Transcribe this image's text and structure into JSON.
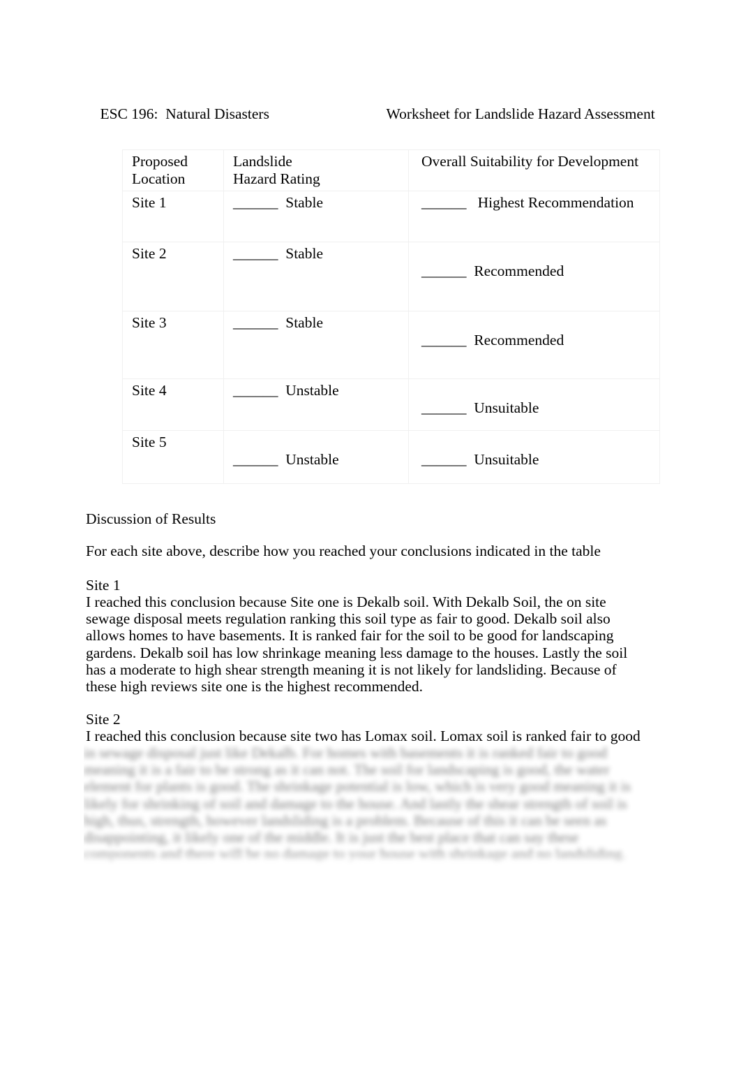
{
  "header": {
    "course": "ESC 196:  Natural Disasters",
    "worksheet_title": "Worksheet for Landslide Hazard Assessment"
  },
  "table": {
    "columns": [
      "Proposed\nLocation",
      "Landslide\nHazard Rating",
      "Overall Suitability for Development"
    ],
    "column_headers_flat": {
      "location": "Proposed Location",
      "rating": "Landslide Hazard Rating",
      "suitability": "Overall Suitability for Development"
    },
    "blank": "______",
    "rows": [
      {
        "location": "Site 1",
        "rating_blank": "______",
        "rating": "Stable",
        "suitability_blank": "______",
        "suitability": "Highest Recommendation",
        "suitability_offset": false
      },
      {
        "location": "Site 2",
        "rating_blank": "______",
        "rating": "Stable",
        "suitability_blank": "______",
        "suitability": "Recommended",
        "suitability_offset": true
      },
      {
        "location": "Site 3",
        "rating_blank": "______",
        "rating": "Stable",
        "suitability_blank": "______",
        "suitability": "Recommended",
        "suitability_offset": true
      },
      {
        "location": "Site 4",
        "rating_blank": "______",
        "rating": "Unstable",
        "suitability_blank": "______",
        "suitability": "Unsuitable",
        "suitability_offset": true
      },
      {
        "location": "Site 5",
        "rating_blank": "______",
        "rating": "Unstable",
        "suitability_blank": "______",
        "suitability": "Unsuitable",
        "suitability_offset": true
      }
    ]
  },
  "discussion": {
    "heading": "Discussion of Results",
    "instruction": "For each site above, describe how you reached your conclusions indicated in the table",
    "site1_heading": "Site 1",
    "site1_text": "I reached this conclusion because Site one is Dekalb soil. With Dekalb Soil, the on site sewage disposal meets regulation ranking this soil type as fair to good.      Dekalb soil also allows homes to have basements. It is    ranked fair for the soil to be good for landscaping gardens. Dekalb soil   has low shrinkage meaning less damage to the houses. Lastly the soil has a moderate to high shear strength meaning it is not likely for landsliding. Because of these high reviews site one is the highest recommended.",
    "site2_heading": "Site 2",
    "site2_text": "I reached this conclusion because site two has Lomax soil. Lomax soil is ranked fair to good",
    "site2_obscured_text": "in sewage disposal just like Dekalb. For homes with basements it is ranked fair to good meaning it is a fair to be strong as it can not. The soil for landscaping is good, the water element for plants is good. The shrinkage potential is low, which is very good meaning it is likely for shrinking of soil and damage to the house. And lastly the shear strength of soil is high, thus, strength, however landsliding is a problem. Because of this it can be seen as disappointing, it likely one of the middle. It is just the best place that can say these components and there will be no damage to your house with shrinkage and no landsliding."
  }
}
